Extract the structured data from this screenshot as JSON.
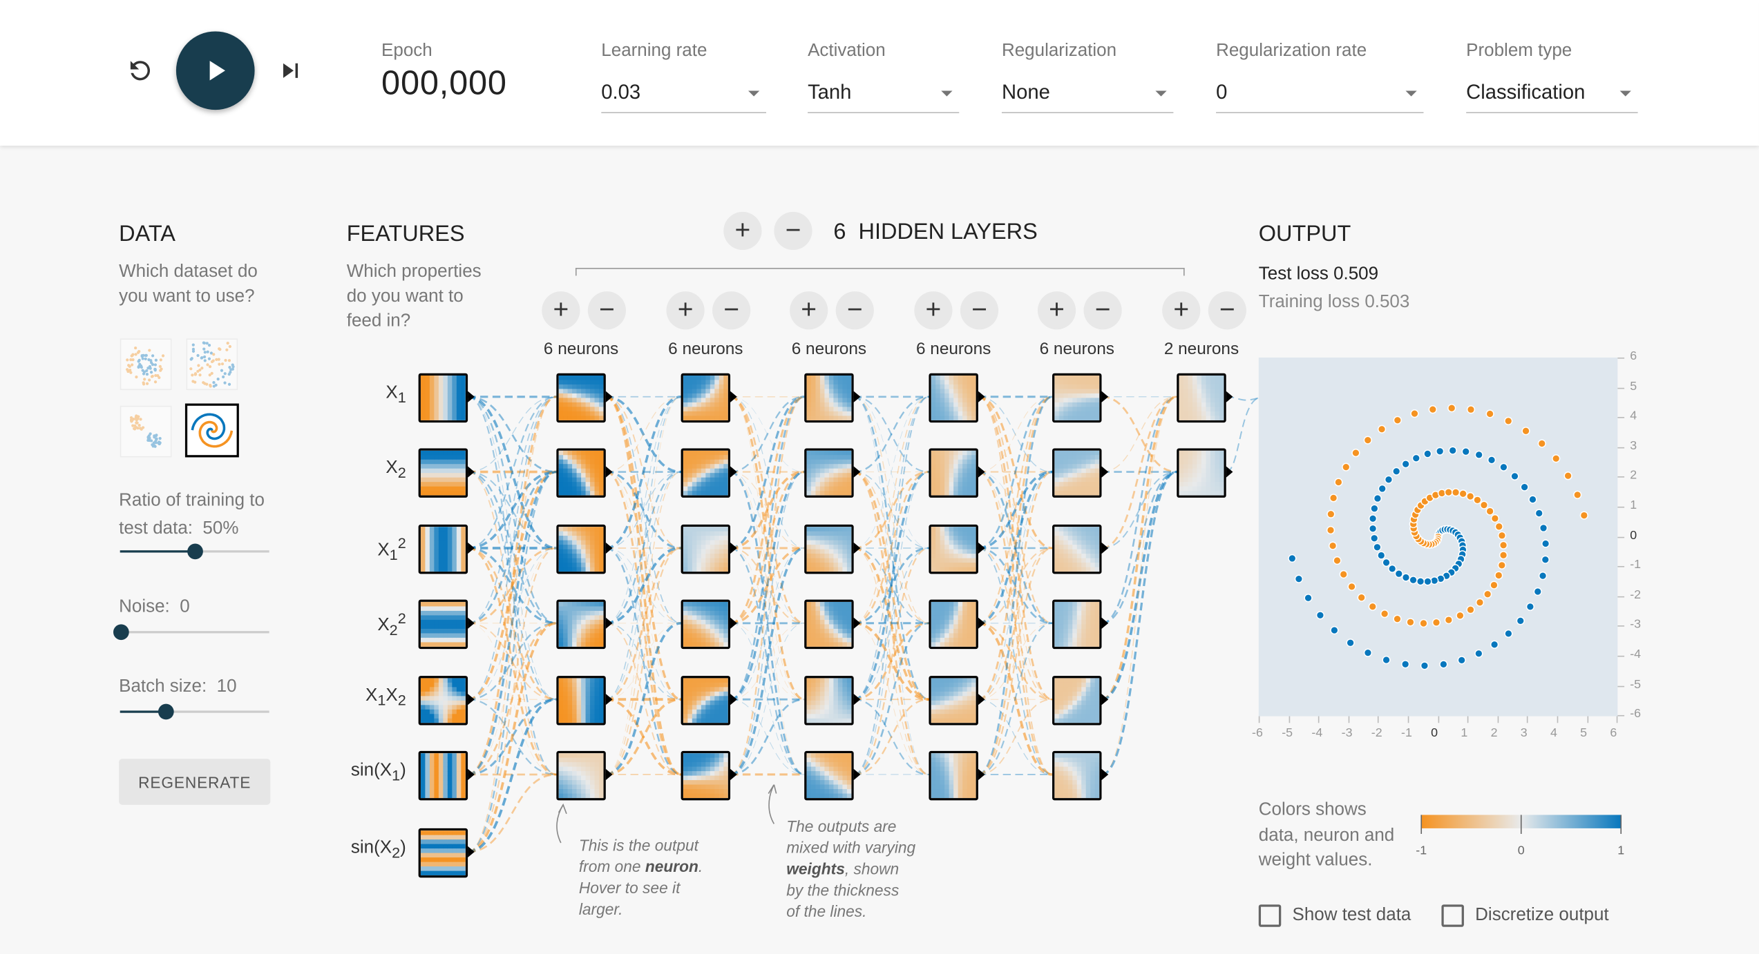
{
  "toolbar": {
    "epoch_label": "Epoch",
    "epoch_value": "000,000",
    "learning_rate": {
      "label": "Learning rate",
      "value": "0.03"
    },
    "activation": {
      "label": "Activation",
      "value": "Tanh"
    },
    "regularization": {
      "label": "Regularization",
      "value": "None"
    },
    "regularization_rate": {
      "label": "Regularization rate",
      "value": "0"
    },
    "problem_type": {
      "label": "Problem type",
      "value": "Classification"
    }
  },
  "data_panel": {
    "title": "DATA",
    "question": "Which dataset do you want to use?",
    "ratio": {
      "label": "Ratio of training to test data:",
      "value": "50%",
      "fraction": 0.5
    },
    "noise": {
      "label": "Noise:",
      "value": "0",
      "fraction": 0.0
    },
    "batch": {
      "label": "Batch size:",
      "value": "10",
      "fraction": 0.31
    },
    "regenerate_label": "REGENERATE"
  },
  "features_panel": {
    "title": "FEATURES",
    "question": "Which properties do you want to feed in?"
  },
  "network": {
    "layer_count": "6",
    "layers_title": "HIDDEN LAYERS",
    "layers": [
      {
        "label": "6 neurons"
      },
      {
        "label": "6 neurons"
      },
      {
        "label": "6 neurons"
      },
      {
        "label": "6 neurons"
      },
      {
        "label": "6 neurons"
      },
      {
        "label": "2 neurons"
      }
    ],
    "annotation_neuron": {
      "l1": "This is the output",
      "l2a": "from one ",
      "l2b": "neuron",
      "l2c": ".",
      "l3": "Hover to see it",
      "l4": "larger."
    },
    "annotation_weights": {
      "l1": "The outputs are",
      "l2": "mixed with varying",
      "l3a": "weights",
      "l3b": ", shown",
      "l4": "by the thickness",
      "l5": "of the lines."
    }
  },
  "output_panel": {
    "title": "OUTPUT",
    "test_loss": "Test loss 0.509",
    "training_loss": "Training loss 0.503",
    "y_ticks": [
      "6",
      "5",
      "4",
      "3",
      "2",
      "1",
      "0",
      "-1",
      "-2",
      "-3",
      "-4",
      "-5",
      "-6"
    ],
    "x_ticks": [
      "-6",
      "-5",
      "-4",
      "-3",
      "-2",
      "-1",
      "0",
      "1",
      "2",
      "3",
      "4",
      "5",
      "6"
    ],
    "legend_text": "Colors shows data, neuron and weight values.",
    "legend_ticks": [
      "-1",
      "0",
      "1"
    ],
    "show_test_data": "Show test data",
    "discretize_output": "Discretize output"
  },
  "colors": {
    "orange": "#f59322",
    "blue": "#0877bd",
    "dark": "#183d4e"
  }
}
